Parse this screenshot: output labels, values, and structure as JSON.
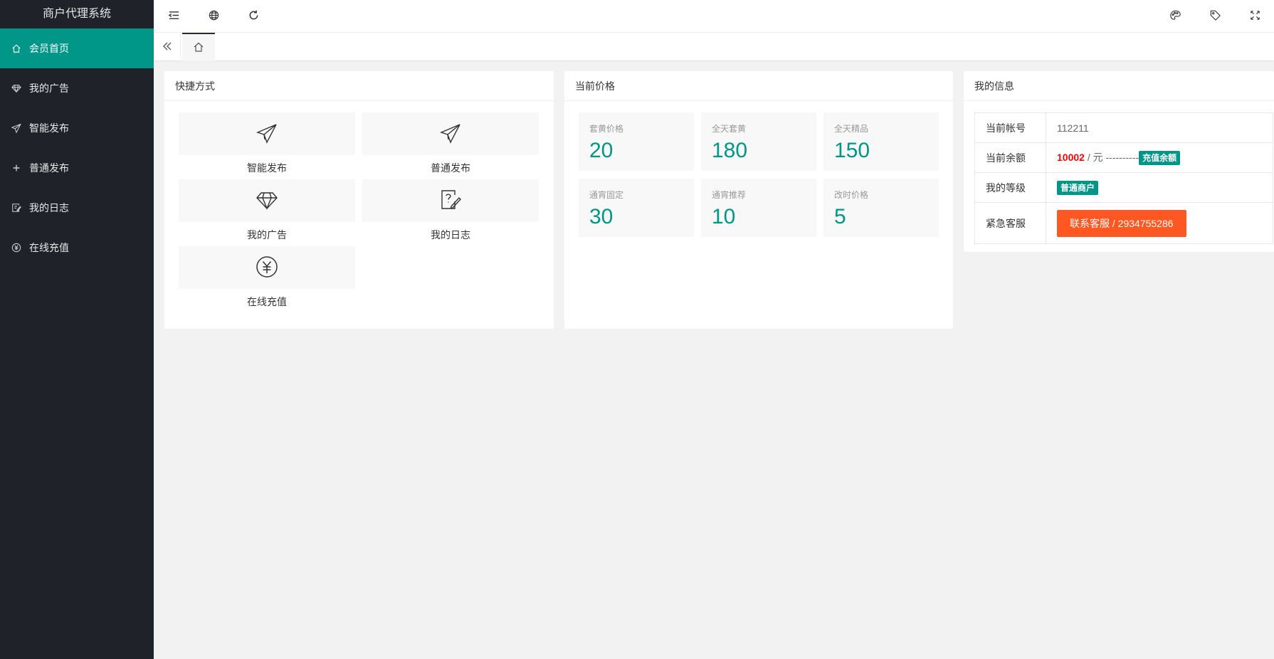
{
  "app": {
    "title": "商户代理系统"
  },
  "sidebar": {
    "items": [
      {
        "label": "会员首页",
        "icon": "home-icon",
        "active": true
      },
      {
        "label": "我的广告",
        "icon": "diamond-icon"
      },
      {
        "label": "智能发布",
        "icon": "paper-plane-icon"
      },
      {
        "label": "普通发布",
        "icon": "plus-icon"
      },
      {
        "label": "我的日志",
        "icon": "log-icon"
      },
      {
        "label": "在线充值",
        "icon": "yen-icon"
      }
    ]
  },
  "header": {
    "left_icons": [
      "menu-shrink-icon",
      "globe-icon",
      "refresh-icon"
    ],
    "right_icons": [
      "palette-icon",
      "tag-icon",
      "fullscreen-icon"
    ]
  },
  "tabs": {
    "back_icon": "double-chevron-left-icon",
    "home_icon": "home-icon"
  },
  "shortcuts": {
    "title": "快捷方式",
    "items": [
      {
        "label": "智能发布",
        "icon": "paper-plane-icon"
      },
      {
        "label": "普通发布",
        "icon": "paper-plane-icon"
      },
      {
        "label": "我的广告",
        "icon": "diamond-icon"
      },
      {
        "label": "我的日志",
        "icon": "log-icon"
      },
      {
        "label": "在线充值",
        "icon": "yen-icon"
      }
    ]
  },
  "prices": {
    "title": "当前价格",
    "items": [
      {
        "label": "套黄价格",
        "value": "20"
      },
      {
        "label": "全天套黄",
        "value": "180"
      },
      {
        "label": "全天精品",
        "value": "150"
      },
      {
        "label": "通宵固定",
        "value": "30"
      },
      {
        "label": "通宵推荐",
        "value": "10"
      },
      {
        "label": "改时价格",
        "value": "5"
      }
    ]
  },
  "info": {
    "title": "我的信息",
    "account_label": "当前帐号",
    "account_value": "112211",
    "balance_label": "当前余额",
    "balance_value": "10002",
    "balance_unit": " / 元 ----------",
    "recharge_badge": "充值余额",
    "level_label": "我的等级",
    "level_value": "普通商户",
    "service_label": "紧急客服",
    "service_button": "联系客服 / 2934755286"
  },
  "colors": {
    "primary": "#009688",
    "sidebar": "#20222a",
    "accent": "#ff5722",
    "balance": "#ff0000"
  }
}
